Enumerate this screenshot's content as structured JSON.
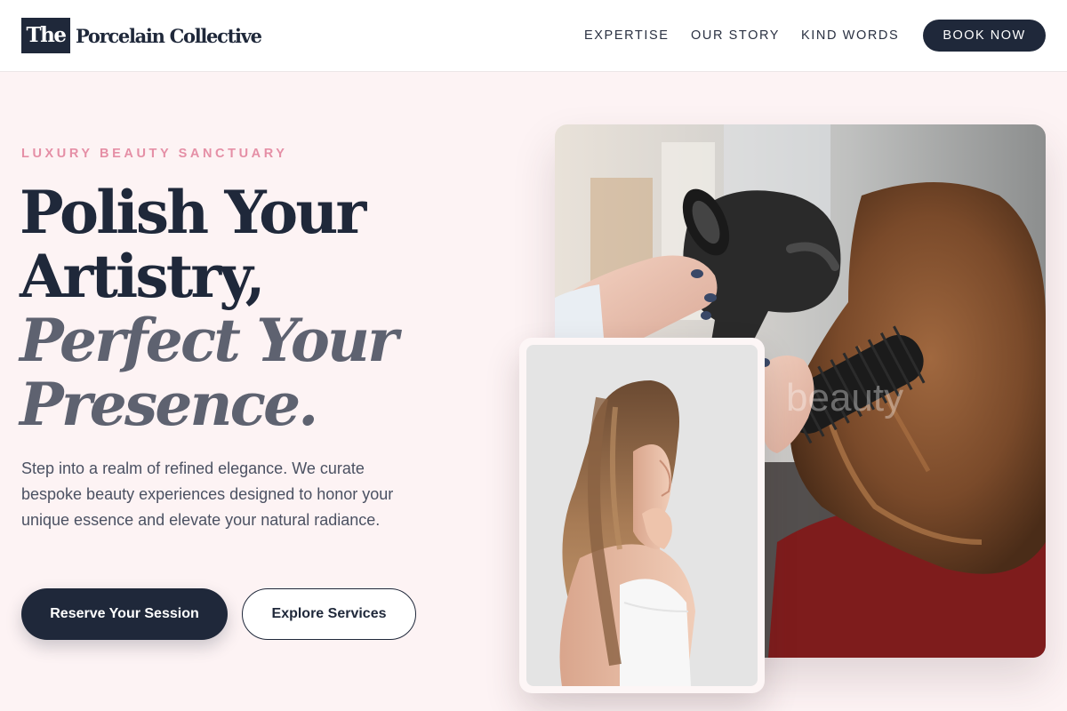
{
  "brand": {
    "logo_mark": "The",
    "name": "Porcelain Collective"
  },
  "nav": {
    "items": [
      {
        "label": "EXPERTISE"
      },
      {
        "label": "OUR STORY"
      },
      {
        "label": "KIND WORDS"
      }
    ],
    "cta_label": "BOOK NOW"
  },
  "hero": {
    "eyebrow": "LUXURY BEAUTY SANCTUARY",
    "headline_line1": "Polish Your",
    "headline_line2": "Artistry,",
    "headline_italic_line1": "Perfect Your",
    "headline_italic_line2": "Presence.",
    "description": "Step into a realm of refined elegance. We curate bespoke beauty experiences designed to honor your unique essence and elevate your natural radiance.",
    "primary_button": "Reserve Your Session",
    "secondary_button": "Explore Services"
  },
  "images": {
    "main_overlay_text": "beauty"
  },
  "colors": {
    "navy": "#1f283a",
    "accent_pink": "#e58fa6",
    "background": "#fdf3f4",
    "muted_italic": "#5e6270"
  }
}
